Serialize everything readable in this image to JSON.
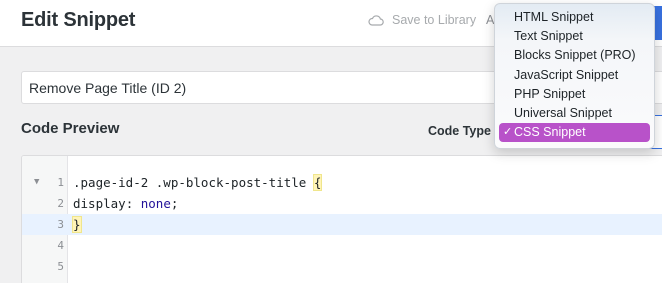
{
  "header": {
    "title": "Edit Snippet",
    "save_to_library": "Save to Library",
    "partial_letter": "A",
    "save_icon": "cloud-icon"
  },
  "snippet": {
    "title_value": "Remove Page Title (ID 2)"
  },
  "code_preview": {
    "label": "Code Preview",
    "code_type_label": "Code Type"
  },
  "editor": {
    "lines": [
      {
        "num": "1",
        "prefix": ".page-id-2 .wp-block-post-title ",
        "brace": "{"
      },
      {
        "num": "2",
        "prop": "display",
        "colon": ": ",
        "value": "none",
        "semi": ";"
      },
      {
        "num": "3",
        "brace": "}"
      },
      {
        "num": "4"
      },
      {
        "num": "5"
      }
    ],
    "fold_icon": "fold-triangle-icon"
  },
  "code_type_menu": {
    "options": [
      "HTML Snippet",
      "Text Snippet",
      "Blocks Snippet (PRO)",
      "JavaScript Snippet",
      "PHP Snippet",
      "Universal Snippet",
      "CSS Snippet"
    ],
    "selected": "CSS Snippet",
    "check_mark": "✓"
  },
  "colors": {
    "accent": "#3871e0",
    "selected_option": "#b852c9"
  }
}
